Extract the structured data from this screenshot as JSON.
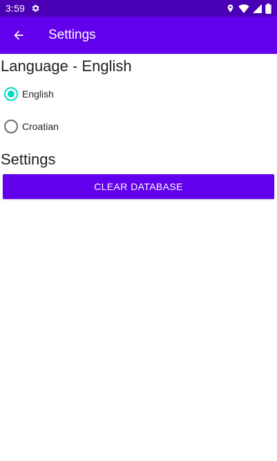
{
  "status_bar": {
    "time": "3:59",
    "icons": [
      "gear-icon",
      "location-icon",
      "wifi-icon",
      "signal-icon",
      "battery-icon"
    ]
  },
  "app_bar": {
    "title": "Settings",
    "back_icon": "arrow-back-icon",
    "color": "#6200ee"
  },
  "language_section": {
    "title": "Language - English",
    "options": [
      {
        "label": "English",
        "checked": true
      },
      {
        "label": "Croatian",
        "checked": false
      }
    ],
    "accent_color": "#03dac5"
  },
  "settings_section": {
    "title": "Settings",
    "clear_button_label": "CLEAR DATABASE"
  }
}
